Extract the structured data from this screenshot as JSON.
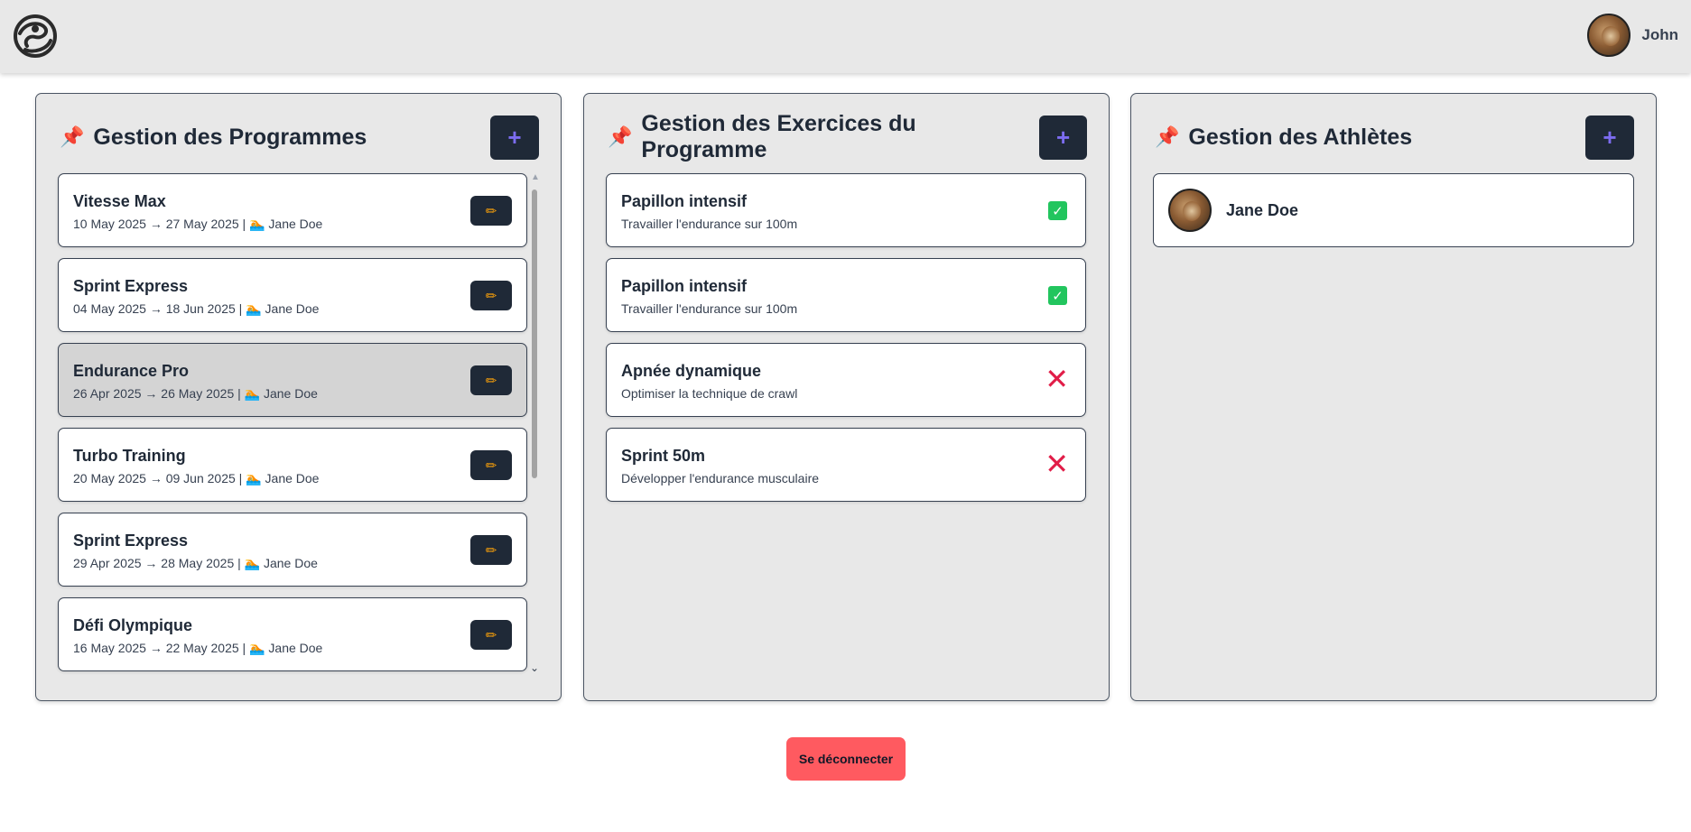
{
  "header": {
    "user_name": "John"
  },
  "programs": {
    "title": "Gestion des Programmes",
    "add_label": "+",
    "edit_icon": "pencil-icon",
    "items": [
      {
        "name": "Vitesse Max",
        "dates": "10 May 2025 → 27 May 2025 | 🏊 Jane Doe"
      },
      {
        "name": "Sprint Express",
        "dates": "04 May 2025 → 18 Jun 2025 | 🏊 Jane Doe"
      },
      {
        "name": "Endurance Pro",
        "dates": "26 Apr 2025 → 26 May 2025 | 🏊 Jane Doe",
        "selected": true
      },
      {
        "name": "Turbo Training",
        "dates": "20 May 2025 → 09 Jun 2025 | 🏊 Jane Doe"
      },
      {
        "name": "Sprint Express",
        "dates": "29 Apr 2025 → 28 May 2025 | 🏊 Jane Doe"
      },
      {
        "name": "Défi Olympique",
        "dates": "16 May 2025 → 22 May 2025 | 🏊 Jane Doe"
      }
    ]
  },
  "exercises": {
    "title": "Gestion des Exercices du Programme",
    "add_label": "+",
    "items": [
      {
        "name": "Papillon intensif",
        "desc": "Travailler l'endurance sur 100m",
        "done": true
      },
      {
        "name": "Papillon intensif",
        "desc": "Travailler l'endurance sur 100m",
        "done": true
      },
      {
        "name": "Apnée dynamique",
        "desc": "Optimiser la technique de crawl",
        "done": false
      },
      {
        "name": "Sprint 50m",
        "desc": "Développer l'endurance musculaire",
        "done": false
      }
    ]
  },
  "athletes": {
    "title": "Gestion des Athlètes",
    "add_label": "+",
    "items": [
      {
        "name": "Jane Doe"
      }
    ]
  },
  "logout_label": "Se déconnecter",
  "colors": {
    "dark_button": "#1f2937",
    "accent_plus": "#7c6cf0",
    "check_green": "#22c55e",
    "cross_red": "#e11d48",
    "logout_red": "#ff5a60"
  }
}
